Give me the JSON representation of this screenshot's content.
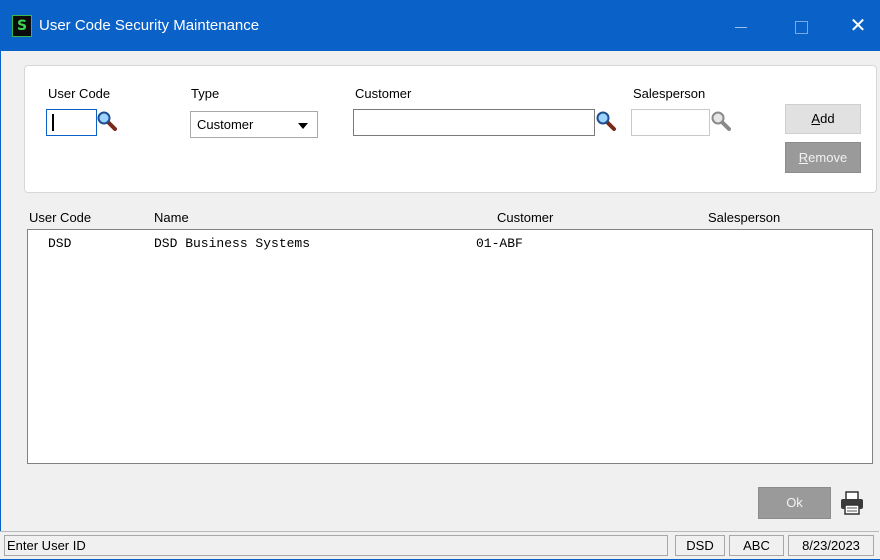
{
  "window": {
    "title": "User Code Security Maintenance",
    "app_icon_letter": "S",
    "close_glyph": "✕"
  },
  "form": {
    "user_code_label": "User Code",
    "user_code_value": "",
    "type_label": "Type",
    "type_value": "Customer",
    "customer_label": "Customer",
    "customer_value": "",
    "salesperson_label": "Salesperson",
    "salesperson_value": "",
    "add_label_underlined": "A",
    "add_label_rest": "dd",
    "remove_label_underlined": "R",
    "remove_label_rest": "emove"
  },
  "table": {
    "columns": [
      "User Code",
      "Name",
      "Customer",
      "Salesperson"
    ],
    "rows": [
      {
        "user_code": "DSD",
        "name": "DSD Business Systems",
        "customer": "01-ABF",
        "salesperson": ""
      }
    ]
  },
  "footer": {
    "ok_label": "Ok"
  },
  "status": {
    "message": "Enter User ID",
    "user": "DSD",
    "company": "ABC",
    "date": "8/23/2023"
  },
  "icons": {
    "lookup": "magnifier-icon",
    "print": "printer-icon",
    "dropdown": "chevron-down-icon"
  }
}
